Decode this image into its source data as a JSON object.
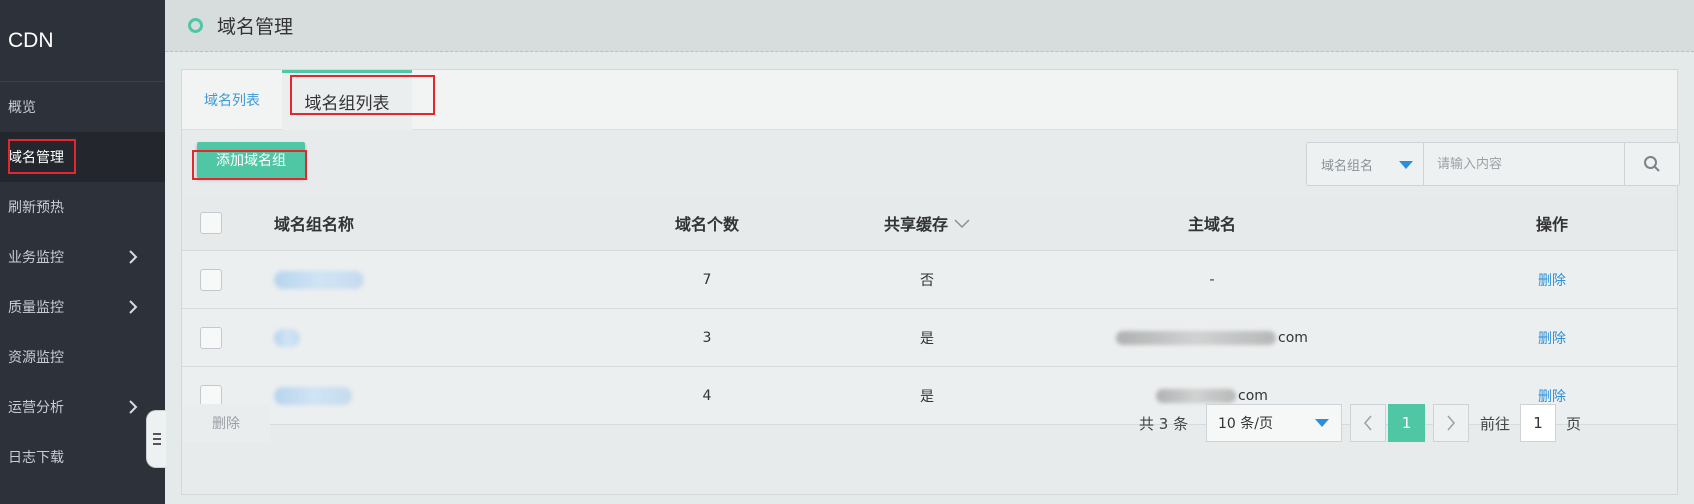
{
  "sidebar": {
    "brand": "CDN",
    "items": [
      {
        "label": "概览",
        "has_arrow": false
      },
      {
        "label": "域名管理",
        "has_arrow": false,
        "active": true
      },
      {
        "label": "刷新预热",
        "has_arrow": false
      },
      {
        "label": "业务监控",
        "has_arrow": true
      },
      {
        "label": "质量监控",
        "has_arrow": true
      },
      {
        "label": "资源监控",
        "has_arrow": false
      },
      {
        "label": "运营分析",
        "has_arrow": true
      },
      {
        "label": "日志下载",
        "has_arrow": false
      }
    ],
    "collapse_icon": "collapse-icon"
  },
  "header": {
    "title": "域名管理"
  },
  "tabs": [
    {
      "label": "域名列表",
      "active": false
    },
    {
      "label": "域名组列表",
      "active": true
    }
  ],
  "toolbar": {
    "add_label": "添加域名组",
    "search": {
      "select_label": "域名组名",
      "placeholder": "请输入内容",
      "icon": "search-icon"
    }
  },
  "table": {
    "columns": {
      "name": "域名组名称",
      "count": "域名个数",
      "share": "共享缓存",
      "main": "主域名",
      "op": "操作"
    },
    "rows": [
      {
        "count": "7",
        "share": "否",
        "main": "-",
        "op": "删除"
      },
      {
        "count": "3",
        "share": "是",
        "main_suffix": "com",
        "op": "删除"
      },
      {
        "count": "4",
        "share": "是",
        "main_suffix": "com",
        "op": "删除"
      }
    ]
  },
  "footer": {
    "delete_label": "删除",
    "total": "共 3 条",
    "page_size": "10 条/页",
    "current_page": "1",
    "goto_label": "前往",
    "goto_value": "1",
    "goto_suffix": "页"
  },
  "colors": {
    "accent": "#4fc7a4",
    "link": "#2e8fd8",
    "sidebar_bg": "#2d3139",
    "highlight": "#e0282e"
  }
}
